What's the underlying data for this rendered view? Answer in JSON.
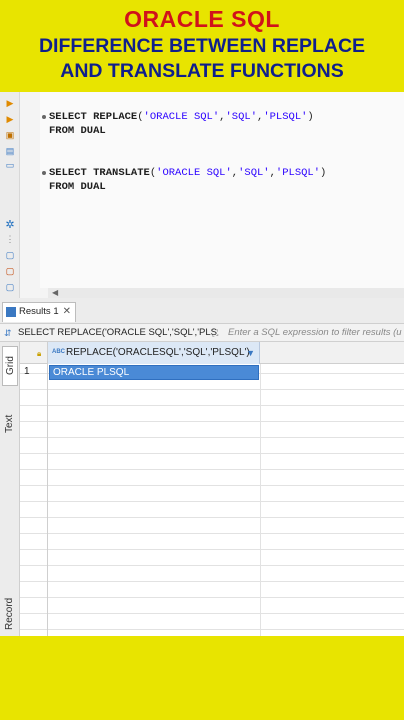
{
  "banner": {
    "line1": "ORACLE SQL",
    "line2": "DIFFERENCE BETWEEN REPLACE",
    "line3": "AND TRANSLATE FUNCTIONS",
    "colors": {
      "background": "#e8e400",
      "line1": "#d0121b",
      "line2": "#0f1f8c"
    }
  },
  "editor": {
    "lines": [
      {
        "keyword": "SELECT",
        "func": "REPLACE",
        "open": "(",
        "args": [
          "'ORACLE SQL'",
          "'SQL'",
          "'PLSQL'"
        ],
        "close": ")"
      },
      {
        "text": "FROM DUAL"
      },
      {
        "keyword": "SELECT",
        "func": "TRANSLATE",
        "open": "(",
        "args": [
          "'ORACLE SQL'",
          "'SQL'",
          "'PLSQL'"
        ],
        "close": ")"
      },
      {
        "text": "FROM DUAL"
      }
    ],
    "gutter_icons": [
      "execute-icon",
      "execute-script-icon",
      "explain-icon",
      "history-icon",
      "console-icon",
      "settings-icon",
      "more-icon",
      "export-icon",
      "import-icon",
      "format-icon"
    ]
  },
  "results": {
    "tab_label": "Results 1",
    "filter_query": "SELECT REPLACE('ORACLE SQL','SQL','PLS",
    "filter_placeholder": "Enter a SQL expression to filter results (u",
    "side_tabs": [
      "Grid",
      "Text",
      "Record"
    ],
    "column_type": "ABC",
    "column_header": "REPLACE('ORACLESQL','SQL','PLSQL')",
    "rows": [
      {
        "num": "1",
        "value": "ORACLE PLSQL"
      }
    ]
  }
}
